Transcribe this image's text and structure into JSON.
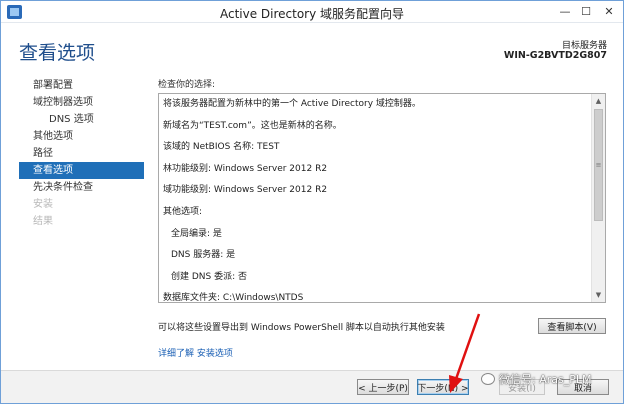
{
  "window": {
    "title": "Active Directory 域服务配置向导",
    "min_glyph": "—",
    "max_glyph": "☐",
    "close_glyph": "✕"
  },
  "header": {
    "page_title": "查看选项",
    "target_label": "目标服务器",
    "target_name": "WIN-G2BVTD2G807"
  },
  "sidebar": {
    "items": [
      {
        "label": "部署配置",
        "state": "normal"
      },
      {
        "label": "域控制器选项",
        "state": "normal"
      },
      {
        "label": "DNS 选项",
        "state": "sub"
      },
      {
        "label": "其他选项",
        "state": "normal"
      },
      {
        "label": "路径",
        "state": "normal"
      },
      {
        "label": "查看选项",
        "state": "active"
      },
      {
        "label": "先决条件检查",
        "state": "normal"
      },
      {
        "label": "安装",
        "state": "disabled"
      },
      {
        "label": "结果",
        "state": "disabled"
      }
    ]
  },
  "review": {
    "label": "检查你的选择:",
    "lines": [
      "将该服务器配置为新林中的第一个 Active Directory 域控制器。",
      "",
      "新域名为“TEST.com”。这也是新林的名称。",
      "",
      "该域的 NetBIOS 名称: TEST",
      "",
      "林功能级别: Windows Server 2012 R2",
      "",
      "域功能级别: Windows Server 2012 R2",
      "",
      "其他选项:",
      "",
      "全局编录: 是",
      "",
      "DNS 服务器: 是",
      "",
      "创建 DNS 委派: 否",
      "",
      "数据库文件夹: C:\\Windows\\NTDS"
    ],
    "indented": [
      12,
      14,
      16
    ]
  },
  "scrollbar": {
    "up_glyph": "▲",
    "down_glyph": "▼",
    "thumb_glyph": "≡"
  },
  "export": {
    "text": "可以将这些设置导出到 Windows PowerShell 脚本以自动执行其他安装",
    "view_script_label": "查看脚本(V)"
  },
  "more_link": "详细了解 安装选项",
  "footer": {
    "prev_label": "< 上一步(P)",
    "next_label": "下一步(N) >",
    "install_label": "安装(I)",
    "cancel_label": "取消"
  },
  "watermark": {
    "text": "微信号: Aras_PLM"
  },
  "colors": {
    "accent": "#1f6fb8",
    "title_blue": "#1f4e8c",
    "link": "#1a5fb4",
    "annotation_arrow": "#e01010"
  }
}
